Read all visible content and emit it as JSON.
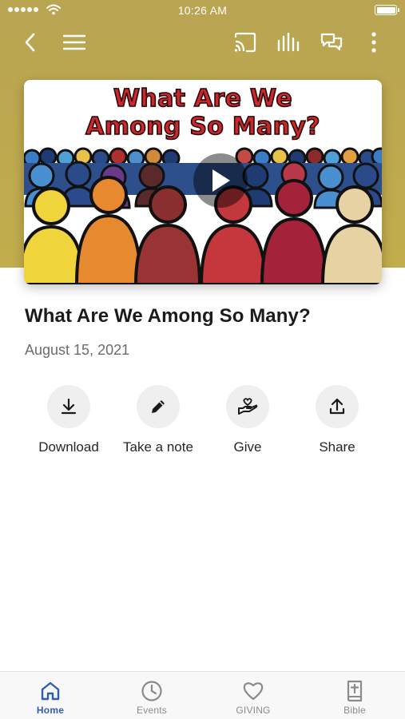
{
  "status_bar": {
    "time": "10:26 AM"
  },
  "colors": {
    "header_gold": "#bea94f",
    "hero_title_red": "#c9282d",
    "active_tab_blue": "#2f5db5",
    "inactive_tab_gray": "#8a8a8a",
    "action_circle_bg": "#efefef"
  },
  "top_nav": {
    "icons": [
      "back-chevron-icon",
      "hamburger-menu-icon",
      "cast-icon",
      "audio-bars-icon",
      "chat-bubbles-icon",
      "more-vertical-icon"
    ]
  },
  "hero": {
    "title_line_1": "What Are We",
    "title_line_2": "Among So Many?",
    "play_icon": "play-icon"
  },
  "sermon": {
    "title": "What Are We Among So Many?",
    "date": "August 15, 2021"
  },
  "actions": [
    {
      "label": "Download",
      "icon": "download-icon"
    },
    {
      "label": "Take a note",
      "icon": "pencil-icon"
    },
    {
      "label": "Give",
      "icon": "heart-hand-icon"
    },
    {
      "label": "Share",
      "icon": "share-upload-icon"
    }
  ],
  "tabs": [
    {
      "label": "Home",
      "icon": "home-icon",
      "active": true
    },
    {
      "label": "Events",
      "icon": "clock-icon",
      "active": false
    },
    {
      "label": "GIVING",
      "icon": "heart-icon",
      "active": false
    },
    {
      "label": "Bible",
      "icon": "bible-icon",
      "active": false
    }
  ]
}
